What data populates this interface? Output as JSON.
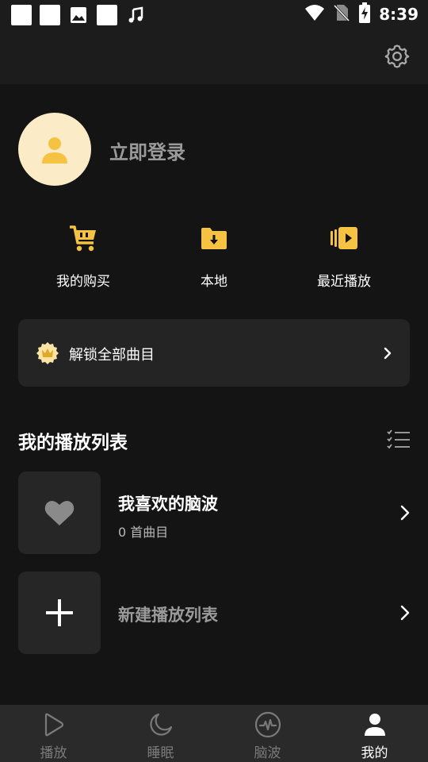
{
  "status_bar": {
    "time": "8:39"
  },
  "profile": {
    "login_label": "立即登录"
  },
  "shortcuts": [
    {
      "label": "我的购买",
      "icon": "cart-icon"
    },
    {
      "label": "本地",
      "icon": "download-folder-icon"
    },
    {
      "label": "最近播放",
      "icon": "recent-play-icon"
    }
  ],
  "unlock_banner": {
    "label": "解锁全部曲目",
    "icon": "crown-badge-icon"
  },
  "playlists_section": {
    "title": "我的播放列表",
    "favorite": {
      "name": "我喜欢的脑波",
      "count": "0 首曲目"
    },
    "new_playlist": {
      "label": "新建播放列表"
    }
  },
  "bottom_nav": [
    {
      "label": "播放",
      "icon": "play-icon"
    },
    {
      "label": "睡眠",
      "icon": "moon-icon"
    },
    {
      "label": "脑波",
      "icon": "brainwave-icon"
    },
    {
      "label": "我的",
      "icon": "person-icon",
      "active": true
    }
  ],
  "colors": {
    "accent": "#f5c242",
    "background": "#141414",
    "card": "#242424",
    "avatar_bg": "#fbecc7"
  }
}
